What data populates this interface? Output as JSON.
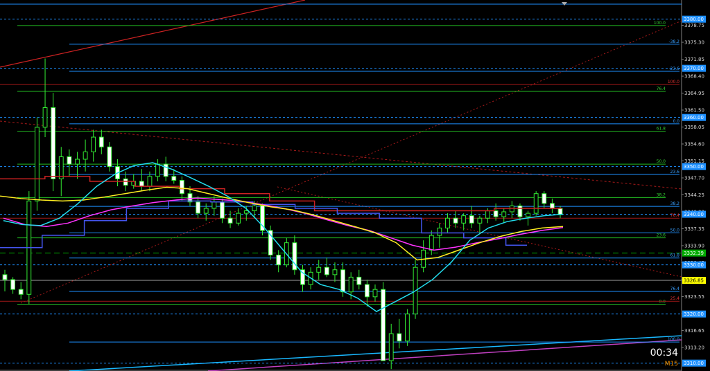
{
  "chart_data": {
    "type": "candlestick",
    "symbol_timeframe": "M15",
    "countdown": "00:34",
    "ylim": [
      3308.4,
      3383.9
    ],
    "y_ticks": [
      "3378.75",
      "3375.30",
      "3371.85",
      "3368.40",
      "3364.95",
      "3361.50",
      "3358.05",
      "3354.60",
      "3351.15",
      "3347.70",
      "3344.25",
      "3340.80",
      "3337.35",
      "3333.90",
      "3330.45",
      "3327.00",
      "3323.55",
      "3320.10",
      "3316.65",
      "3313.20"
    ],
    "price_tags": [
      {
        "text": "3380.00",
        "value": 3380.0,
        "bg": "#1e90ff",
        "fg": "#ffffff"
      },
      {
        "text": "3370.00",
        "value": 3370.0,
        "bg": "#1e90ff",
        "fg": "#ffffff"
      },
      {
        "text": "3360.00",
        "value": 3360.0,
        "bg": "#1e90ff",
        "fg": "#ffffff"
      },
      {
        "text": "3350.00",
        "value": 3350.0,
        "bg": "#1e90ff",
        "fg": "#ffffff"
      },
      {
        "text": "3340.00",
        "value": 3340.3,
        "bg": "#1e90ff",
        "fg": "#ffffff"
      },
      {
        "text": "3332.39",
        "value": 3332.4,
        "bg": "#00aa00",
        "fg": "#ffffff"
      },
      {
        "text": "3330.00",
        "value": 3330.0,
        "bg": "#1e90ff",
        "fg": "#ffffff"
      },
      {
        "text": "3326.85",
        "value": 3326.85,
        "bg": "#ffff00",
        "fg": "#000000"
      },
      {
        "text": "3320.00",
        "value": 3320.0,
        "bg": "#1e90ff",
        "fg": "#ffffff"
      },
      {
        "text": "3310.00",
        "value": 3310.0,
        "bg": "#1e90ff",
        "fg": "#ffffff"
      }
    ],
    "fib_green": [
      {
        "label": "100.0",
        "value": 3378.7
      },
      {
        "label": "76.4",
        "value": 3365.3
      },
      {
        "label": "61.8",
        "value": 3357.2
      },
      {
        "label": "50.0",
        "value": 3350.5
      },
      {
        "label": "38.2",
        "value": 3343.7
      },
      {
        "label": "23.6",
        "value": 3335.5
      },
      {
        "label": "0.0",
        "value": 3322.0
      }
    ],
    "fib_blue": [
      {
        "label": "-38.2",
        "value": 3374.9
      },
      {
        "label": "-23.6",
        "value": 3369.4
      },
      {
        "label": "0.0",
        "value": 3358.7
      },
      {
        "label": "23.6",
        "value": 3348.4
      },
      {
        "label": "38.2",
        "value": 3341.9
      },
      {
        "label": "50.0",
        "value": 3336.5
      },
      {
        "label": "61.8",
        "value": 3331.4
      },
      {
        "label": "76.4",
        "value": 3324.6
      },
      {
        "label": "100.0",
        "value": 3314.3
      }
    ],
    "fib_red": [
      {
        "label": "100.0",
        "value": 3366.7
      },
      {
        "label": "76.4",
        "value": 3339.5
      },
      {
        "label": "25.4",
        "value": 3322.6
      }
    ],
    "candles": [
      [
        3328.0,
        3329.0,
        3324.6,
        3327.0
      ],
      [
        3327.0,
        3327.5,
        3324.1,
        3325.0
      ],
      [
        3325.0,
        3326.5,
        3323.0,
        3324.0
      ],
      [
        3324.0,
        3345.0,
        3322.0,
        3343.0
      ],
      [
        3343.0,
        3360.0,
        3341.0,
        3358.0
      ],
      [
        3358.0,
        3372.0,
        3356.0,
        3362.0
      ],
      [
        3362.0,
        3365.0,
        3345.0,
        3347.5
      ],
      [
        3347.5,
        3354.0,
        3344.0,
        3352.0
      ],
      [
        3352.0,
        3353.5,
        3348.0,
        3350.5
      ],
      [
        3350.5,
        3353.0,
        3347.5,
        3351.5
      ],
      [
        3351.5,
        3355.5,
        3349.0,
        3353.0
      ],
      [
        3353.0,
        3357.5,
        3351.0,
        3356.0
      ],
      [
        3356.0,
        3357.5,
        3352.5,
        3354.0
      ],
      [
        3354.0,
        3355.0,
        3349.0,
        3350.0
      ],
      [
        3350.0,
        3351.5,
        3346.0,
        3347.5
      ],
      [
        3347.5,
        3349.0,
        3345.0,
        3346.2
      ],
      [
        3346.2,
        3348.5,
        3345.5,
        3347.0
      ],
      [
        3347.0,
        3349.5,
        3345.0,
        3346.0
      ],
      [
        3346.0,
        3349.0,
        3345.0,
        3348.0
      ],
      [
        3348.0,
        3351.5,
        3347.0,
        3350.5
      ],
      [
        3350.5,
        3352.0,
        3347.0,
        3348.0
      ],
      [
        3348.0,
        3349.5,
        3346.5,
        3347.2
      ],
      [
        3347.2,
        3348.0,
        3343.0,
        3344.5
      ],
      [
        3344.5,
        3346.0,
        3342.0,
        3342.8
      ],
      [
        3342.8,
        3344.0,
        3339.5,
        3340.5
      ],
      [
        3340.5,
        3342.5,
        3339.0,
        3341.5
      ],
      [
        3341.5,
        3344.0,
        3340.0,
        3342.8
      ],
      [
        3342.8,
        3343.5,
        3338.5,
        3339.5
      ],
      [
        3339.5,
        3341.0,
        3337.5,
        3338.5
      ],
      [
        3338.5,
        3341.5,
        3338.0,
        3340.5
      ],
      [
        3340.5,
        3342.0,
        3339.0,
        3341.0
      ],
      [
        3341.0,
        3343.0,
        3339.5,
        3342.0
      ],
      [
        3342.0,
        3342.5,
        3336.0,
        3337.0
      ],
      [
        3337.0,
        3338.0,
        3331.0,
        3332.0
      ],
      [
        3332.0,
        3333.0,
        3328.5,
        3330.0
      ],
      [
        3330.0,
        3335.5,
        3329.5,
        3334.5
      ],
      [
        3334.5,
        3336.0,
        3328.0,
        3329.0
      ],
      [
        3329.0,
        3330.0,
        3324.5,
        3326.0
      ],
      [
        3326.0,
        3329.5,
        3325.0,
        3328.5
      ],
      [
        3328.5,
        3331.0,
        3327.0,
        3329.5
      ],
      [
        3329.5,
        3331.5,
        3327.5,
        3328.0
      ],
      [
        3328.0,
        3330.5,
        3326.5,
        3329.0
      ],
      [
        3329.0,
        3330.5,
        3323.5,
        3324.5
      ],
      [
        3324.5,
        3328.5,
        3323.0,
        3327.5
      ],
      [
        3327.5,
        3329.0,
        3325.0,
        3326.0
      ],
      [
        3326.0,
        3327.0,
        3321.5,
        3323.5
      ],
      [
        3323.5,
        3326.0,
        3322.5,
        3325.0
      ],
      [
        3325.0,
        3326.5,
        3320.5,
        3310.5
      ],
      [
        3310.5,
        3318.0,
        3308.8,
        3316.0
      ],
      [
        3316.0,
        3319.0,
        3313.0,
        3314.5
      ],
      [
        3314.5,
        3321.0,
        3313.5,
        3320.0
      ],
      [
        3320.0,
        3331.0,
        3319.0,
        3329.5
      ],
      [
        3329.5,
        3335.0,
        3328.5,
        3333.0
      ],
      [
        3333.0,
        3337.0,
        3332.0,
        3336.0
      ],
      [
        3336.0,
        3338.5,
        3333.5,
        3337.5
      ],
      [
        3337.5,
        3340.5,
        3336.5,
        3339.5
      ],
      [
        3339.5,
        3341.0,
        3337.5,
        3338.5
      ],
      [
        3338.5,
        3340.5,
        3337.0,
        3340.0
      ],
      [
        3340.0,
        3342.0,
        3337.5,
        3338.5
      ],
      [
        3338.5,
        3340.0,
        3336.5,
        3339.5
      ],
      [
        3339.5,
        3341.5,
        3338.5,
        3341.0
      ],
      [
        3341.0,
        3342.5,
        3339.0,
        3339.8
      ],
      [
        3339.8,
        3341.5,
        3338.5,
        3340.8
      ],
      [
        3340.8,
        3343.0,
        3339.5,
        3342.0
      ],
      [
        3342.0,
        3342.5,
        3339.0,
        3339.8
      ],
      [
        3339.8,
        3341.0,
        3338.0,
        3340.5
      ],
      [
        3340.5,
        3345.0,
        3340.0,
        3344.5
      ],
      [
        3344.5,
        3345.0,
        3341.5,
        3342.5
      ],
      [
        3342.5,
        3343.5,
        3340.5,
        3341.5
      ],
      [
        3341.5,
        3342.0,
        3339.5,
        3340.2
      ]
    ],
    "ma_cyan": [
      3339.0,
      3338.2,
      3338.0,
      3339.5,
      3342.5,
      3346.0,
      3348.5,
      3350.2,
      3350.8,
      3349.5,
      3347.8,
      3346.0,
      3344.0,
      3341.5,
      3337.5,
      3333.0,
      3328.5,
      3326.0,
      3325.0,
      3323.2,
      3320.5,
      3322.5,
      3324.5,
      3327.0,
      3330.5,
      3335.0,
      3337.5,
      3338.8,
      3339.5,
      3340.0,
      3340.3
    ],
    "ma_yellow": [
      3344.0,
      3343.5,
      3343.2,
      3343.0,
      3343.2,
      3343.8,
      3344.5,
      3345.2,
      3345.8,
      3345.5,
      3344.5,
      3343.5,
      3342.6,
      3341.8,
      3341.2,
      3340.2,
      3339.0,
      3337.8,
      3336.5,
      3334.5,
      3331.0,
      3331.5,
      3333.0,
      3334.5,
      3335.8,
      3336.8,
      3337.5,
      3337.8
    ],
    "ma_magenta": [
      3339.5,
      3338.2,
      3337.8,
      3338.5,
      3340.0,
      3341.2,
      3342.0,
      3342.7,
      3343.2,
      3343.6,
      3343.3,
      3343.0,
      3342.3,
      3341.5,
      3340.5,
      3339.2,
      3338.0,
      3337.0,
      3335.5,
      3334.0,
      3333.0,
      3333.6,
      3334.5,
      3335.3,
      3336.2,
      3337.0,
      3337.6
    ],
    "ma_red_step": [
      3347.5,
      3347.5,
      3348.0,
      3348.0,
      3347.0,
      3347.0,
      3346.0,
      3346.0,
      3345.5,
      3345.5,
      3344.5,
      3344.5,
      3343.0,
      3343.0,
      3341.0,
      3341.0,
      3341.0,
      3341.0,
      3341.0,
      3341.0,
      3341.0,
      3341.0,
      3341.5,
      3341.5,
      3341.5,
      3341.5
    ],
    "ma_blue_step": [
      3333.5,
      3333.5,
      3336.0,
      3336.0,
      3339.0,
      3339.0,
      3341.5,
      3341.5,
      3343.0,
      3343.0,
      3342.8,
      3342.8,
      3342.3,
      3342.3,
      3341.5,
      3341.5,
      3340.5,
      3340.5,
      3339.5,
      3339.5,
      3336.5,
      3336.5,
      3335.5,
      3335.5,
      3334.0,
      3334.0
    ]
  }
}
